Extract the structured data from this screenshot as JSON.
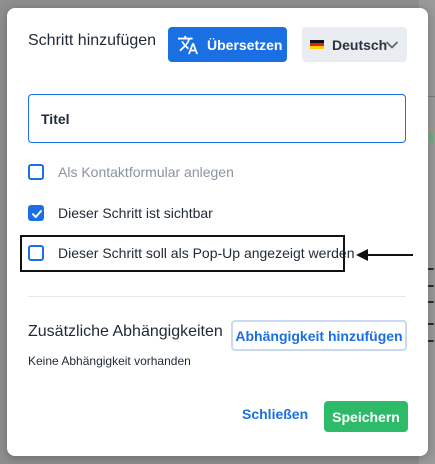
{
  "dialog": {
    "title": "Schritt hinzufügen",
    "translate_label": "Übersetzen",
    "language": "Deutsch",
    "title_field_placeholder": "Titel",
    "checkboxes": [
      {
        "label": "Als Kontaktformular anlegen",
        "checked": false
      },
      {
        "label": "Dieser Schritt ist sichtbar",
        "checked": true
      },
      {
        "label": "Dieser Schritt soll als Pop-Up angezeigt werden",
        "checked": false
      }
    ],
    "dependencies_title": "Zusätzliche Abhängigkeiten",
    "add_dependency_label": "Abhängigkeit hinzufügen",
    "no_dependency_text": "Keine Abhängigkeit vorhanden",
    "close_label": "Schließen",
    "save_label": "Speichern"
  },
  "icons": {
    "translate": "translate-icon",
    "flag": "german-flag-icon",
    "chevron": "chevron-down-icon",
    "check": "check-icon",
    "arrow": "arrow-left-icon"
  },
  "colors": {
    "primary": "#1a6fe3",
    "success": "#2dbb6a",
    "overlay": "#8e8e8e"
  }
}
